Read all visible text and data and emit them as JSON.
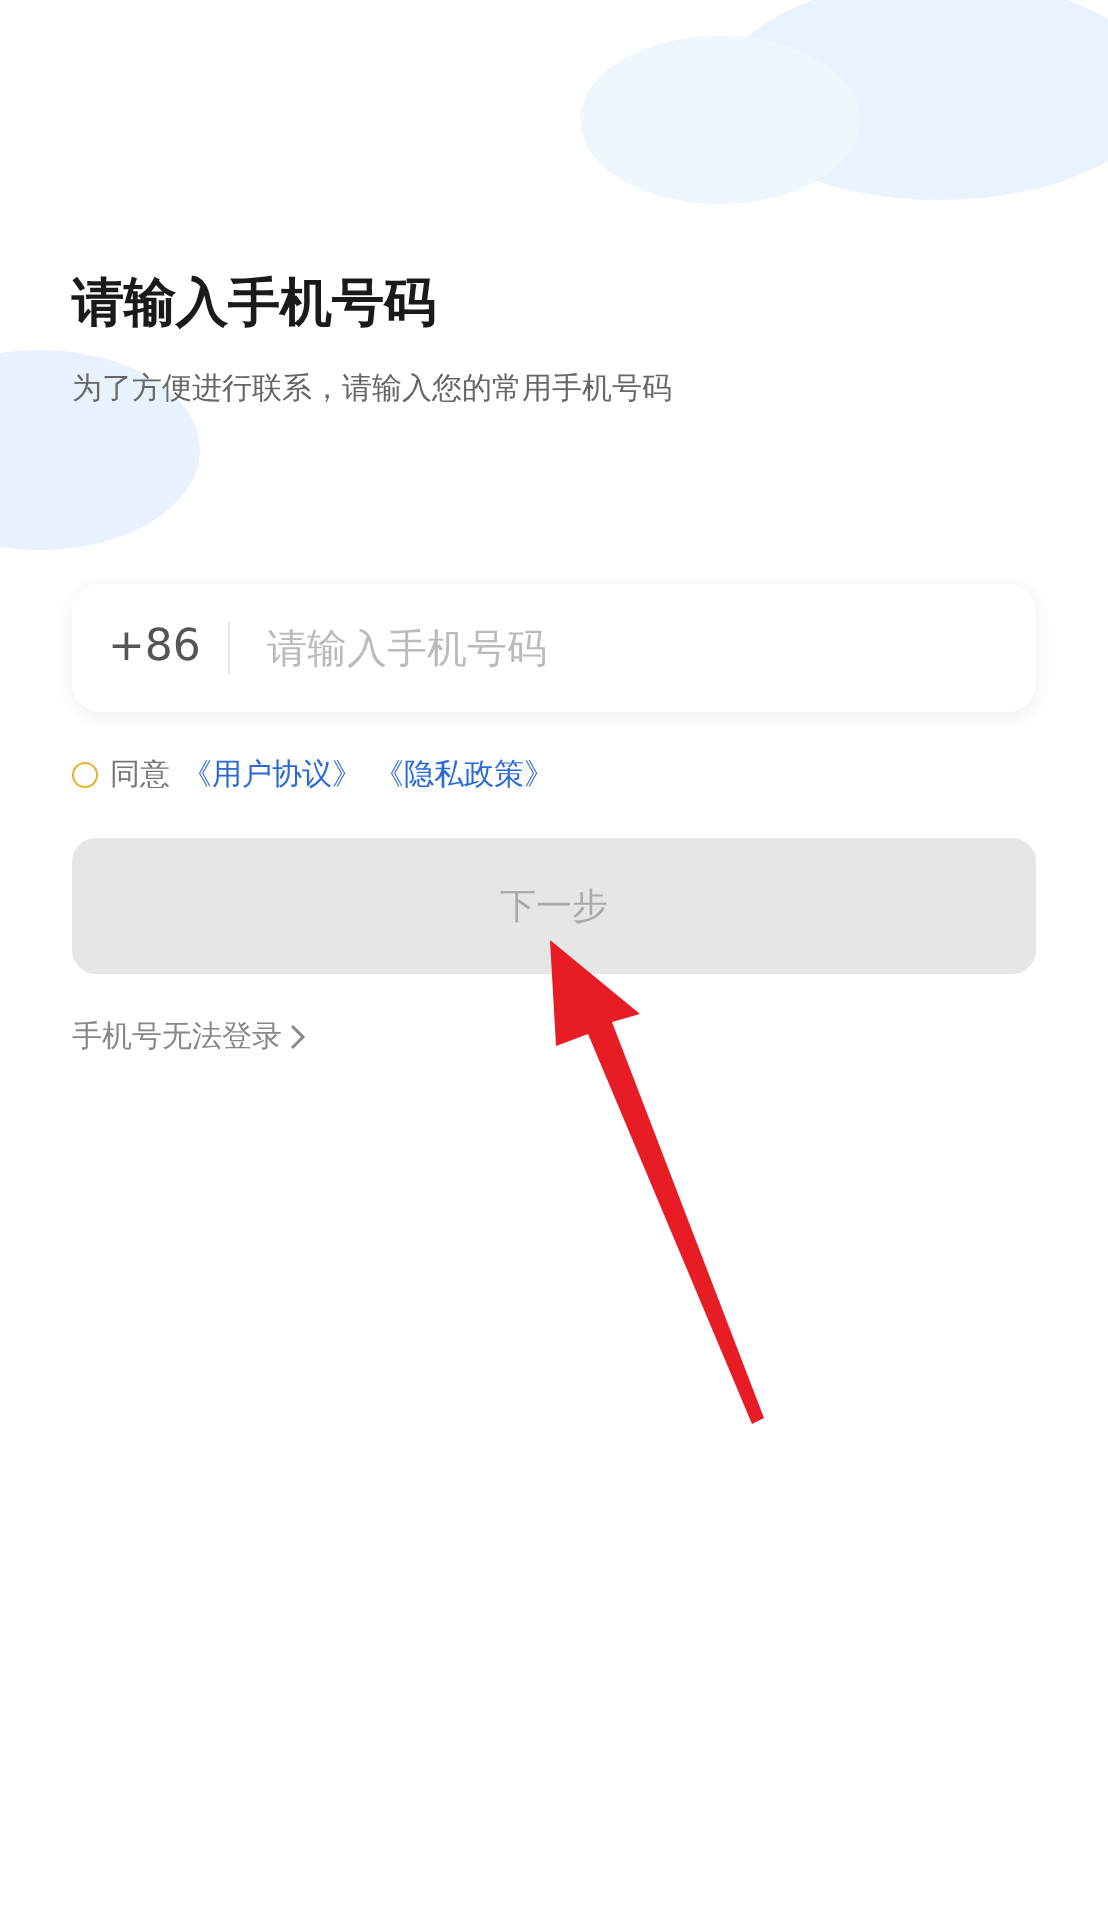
{
  "title": "请输入手机号码",
  "subtitle": "为了方便进行联系，请输入您的常用手机号码",
  "phone_field": {
    "country_code": "+86",
    "placeholder": "请输入手机号码"
  },
  "agreement": {
    "checked": false,
    "prefix": "同意",
    "links": [
      "《用户协议》",
      "《隐私政策》"
    ]
  },
  "next_button": {
    "label": "下一步",
    "disabled": true
  },
  "help_link": {
    "label": "手机号无法登录"
  }
}
